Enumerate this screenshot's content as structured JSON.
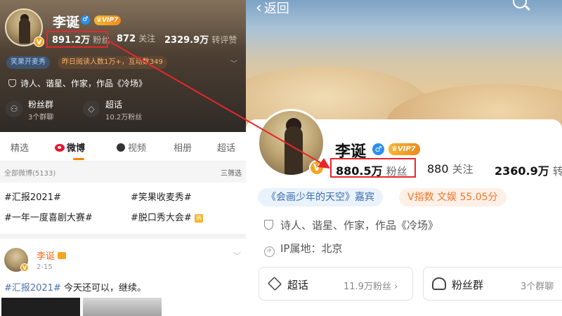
{
  "left": {
    "name": "李诞",
    "vip_label": "VIP7",
    "v_mark": "V",
    "gender_mark": "♂",
    "stats": {
      "followers_value": "891.2万",
      "followers_label": "粉丝",
      "following_value": "872",
      "following_label": "关注",
      "likes_value": "2329.9万",
      "likes_label": "转评赞"
    },
    "tag_blue": "笑果开麦秀",
    "tag_orange": "昨日阅读人数1万+，互动数349",
    "bio": "诗人、谐星、作家，作品《冷场》",
    "cards": [
      {
        "title": "粉丝群",
        "sub": "3个群聊",
        "icon": "people-icon"
      },
      {
        "title": "超话",
        "sub": "10.2万粉丝",
        "icon": "diamond-icon"
      }
    ],
    "tabs": [
      "精选",
      "微博",
      "视频",
      "相册",
      "超话"
    ],
    "active_tab": "微博",
    "all_weibo_label": "全部微博(5133)",
    "filter_label": "三筛选",
    "topics": [
      "#汇报2021#",
      "#笑果收麦秀#",
      "#一年一度喜剧大赛#",
      "#脱口秀大会#"
    ],
    "topic_hot_mark": "热",
    "post": {
      "name": "李诞",
      "date": "2-15",
      "tag": "#汇报2021#",
      "text": " 今天还可以，继续。",
      "more": "﹀"
    }
  },
  "right": {
    "back_label": "返回",
    "name": "李诞",
    "vip_label": "VIP7",
    "gender_mark": "♂",
    "v_mark": "V",
    "stats": {
      "followers_value": "880.5万",
      "followers_label": "粉丝",
      "following_value": "880",
      "following_label": "关注",
      "likes_value": "2360.9万",
      "likes_label": "转"
    },
    "pill_blue": "《会画少年的天空》嘉宾",
    "pill_orange": "V指数 文娱 55.05分",
    "bio": "诗人、谐星、作家，作品《冷场》",
    "ip_label": "IP属地：北京",
    "ip_icon_text": "IP",
    "boxes": [
      {
        "title": "超话",
        "sub": "11.9万粉丝 ›",
        "icon": "diamond-icon"
      },
      {
        "title": "粉丝群",
        "sub": "3个群聊",
        "icon": "people-icon"
      }
    ]
  },
  "colors": {
    "highlight_red": "#e8262a",
    "accent_orange": "#ff8200",
    "weibo_red": "#e6162d",
    "link_blue": "#4b74b0"
  }
}
